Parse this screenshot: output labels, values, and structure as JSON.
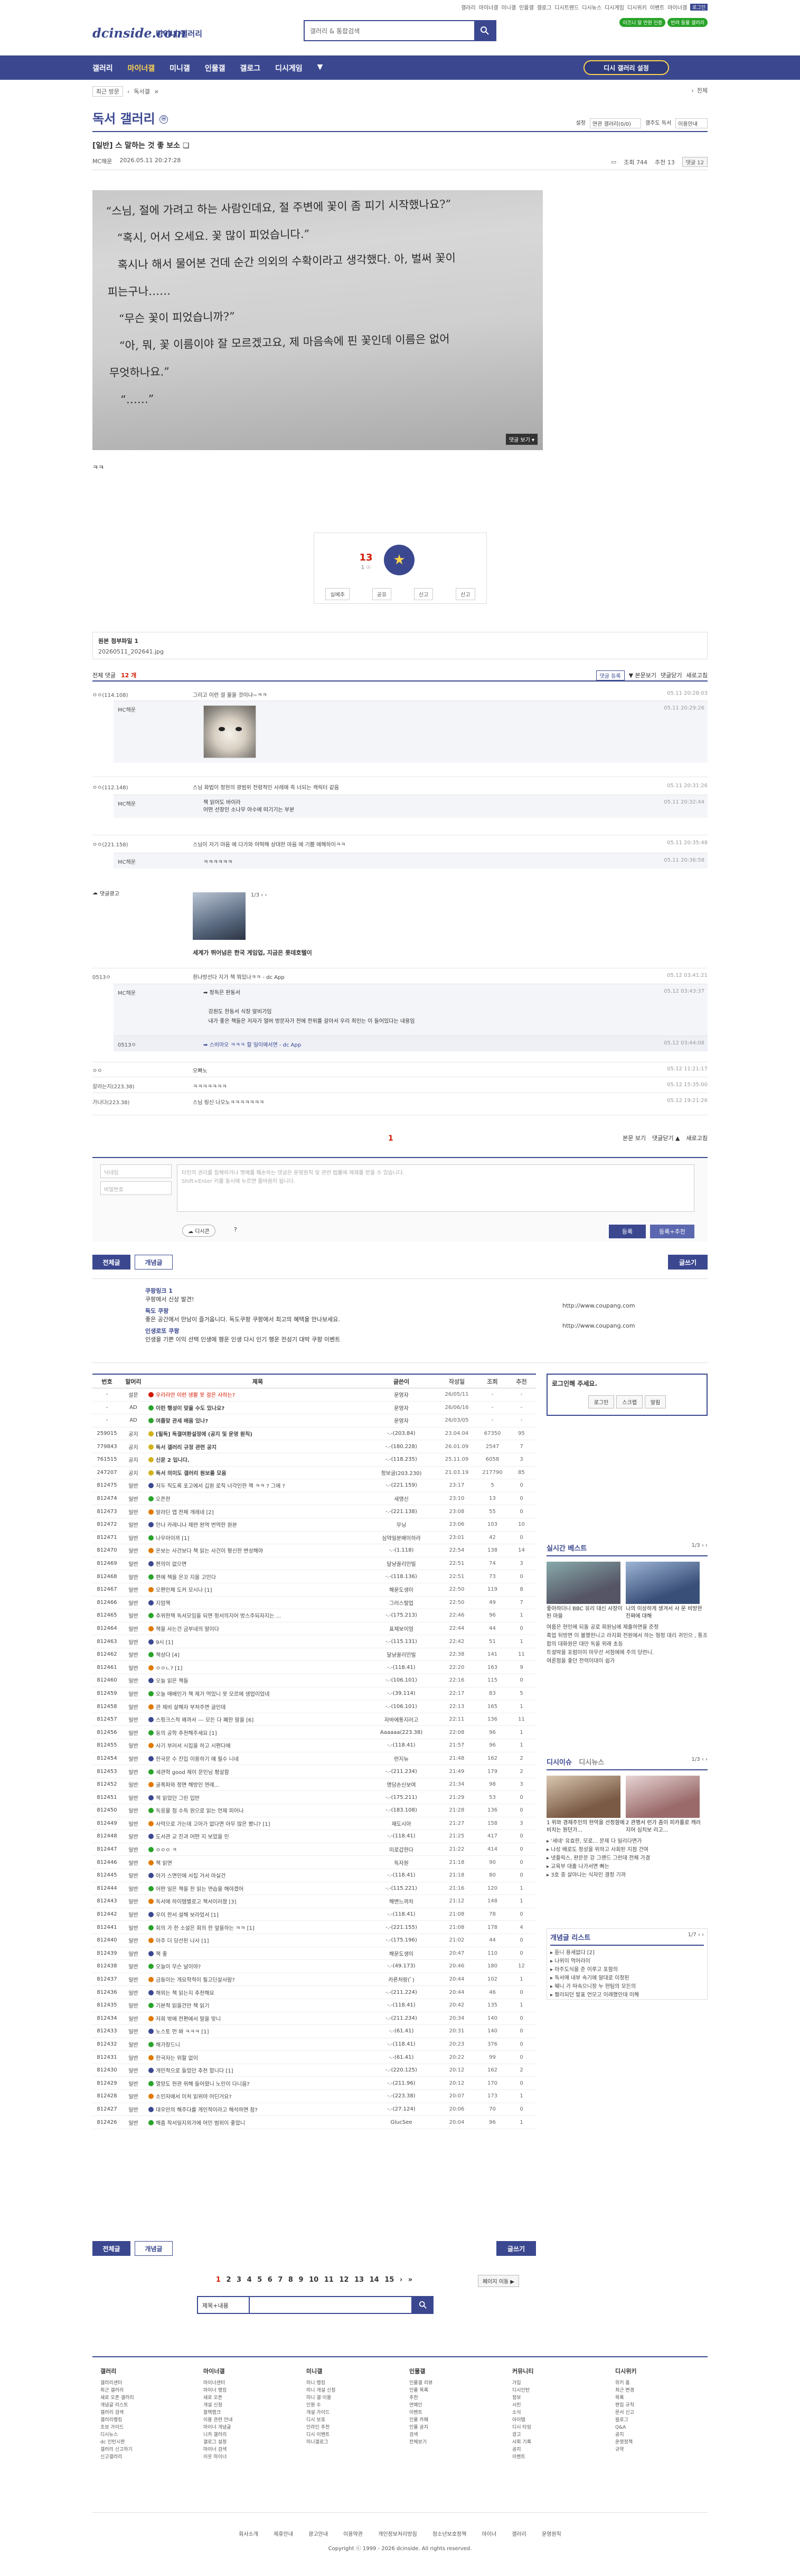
{
  "top": {
    "links": [
      "갤러리",
      "마이너갤",
      "미니갤",
      "인물갤",
      "갤로그",
      "디시트렌드",
      "디시뉴스",
      "디시게임",
      "디시위키",
      "이벤트",
      "마이너갤"
    ],
    "badge": "로그인",
    "pills": [
      "이즈니 알 만원 인증",
      "반려 동물 갤러리"
    ]
  },
  "logo": "dcinside.com",
  "logo_sub": "마이너 갤러리",
  "search": {
    "placeholder": "갤러리 & 통합검색"
  },
  "gnb": {
    "items": [
      "갤러리",
      "마이너갤",
      "미니갤",
      "인물갤",
      "갤로그",
      "디시게임"
    ],
    "cta": "디시 갤러리 설정"
  },
  "subnav": {
    "items": [
      "최근 방문",
      "독서갤"
    ],
    "right": "전체"
  },
  "gallery": {
    "title": "독서 갤러리",
    "badge": "ⓜ",
    "opts": [
      "설정",
      "연관 갤러리(0/0)",
      "갤주도 독서",
      "이용안내"
    ]
  },
  "post": {
    "title": "[일반] 스 말하는 것 좋 보소 ❏",
    "author": "MC해운",
    "date": "2026.05.11 20:27:28",
    "views": "조회 744",
    "reco": "추천 13",
    "cmt_btn": "댓글 12",
    "photo_text": "“스님, 절에 가려고 하는 사람인데요, 절 주변에 꽃이 좀 피기 시작했나요?”\n   “혹시, 어서 오세요. 꽃 많이 피었습니다.”\n   혹시나 해서 물어본 건데 순간 의외의 수확이라고 생각했다. 아, 벌써 꽃이\n피는구나……\n   “무슨 꽃이 피었습니까?”\n   “아, 뭐, 꽃 이름이야 잘 모르겠고요, 제 마음속에 핀 꽃인데 이름은 없어\n무엇하나요.”\n   “……”",
    "photo_more": "댓글 보기 ▾",
    "tilde": "ㅋㅋ"
  },
  "reco": {
    "num": "13",
    "sub": "1 ☉",
    "label": "개념",
    "bar": [
      "실베추",
      "공유",
      "신고",
      "신고"
    ]
  },
  "attach": {
    "label": "원본 첨부파일 1",
    "file": "20260511_202641.jpg"
  },
  "comments_head": {
    "label": "전체 댓글",
    "count": "12 개",
    "opts": [
      "▼ 본문보기",
      "댓글닫기",
      "새로고침"
    ],
    "all": "댓글 등록"
  },
  "comments": [
    {
      "nick": "ㅇㅇ(114.108)",
      "body": "그리고 이런 걸 물을 것이냐~ㅋㅋ",
      "date": "05.11 20:28:03"
    },
    {
      "nick": "MC해운",
      "body": "",
      "date": "05.11 20:29:26",
      "reply": true
    },
    {
      "nick": "ㅇㅇ(112.148)",
      "body": "스님 화법이 정현의 광범위 전령적인 사례에 즉 너되는 캐릭터 같음",
      "date": "05.11 20:31:26"
    },
    {
      "nick": "MC해운",
      "body": "책 읽어도 바이라\n어떤 선창인 소나무 아수에 떠기기는 부분",
      "date": "05.11 20:32:44",
      "reply": true
    },
    {
      "nick": "ㅇㅇ(221.158)",
      "body": "스님이 저기 마음 에 다가와 어떡해 상대한 마음 에 기쁨 에해하이ㅋㅋ",
      "date": "05.11 20:35:48"
    },
    {
      "nick": "MC해운",
      "body": "ㅋㅋㅋㅋㅋㅋ",
      "date": "05.11 20:36:58",
      "reply": true
    }
  ],
  "ad": {
    "label": "댓글광고",
    "pages": "1/3 ‹ ›",
    "title": "세계가 뛰어넘은 한국 게임업, 지금은 롯데호텔이"
  },
  "comments2": [
    {
      "nick": "0513ㅇ",
      "body": "흰나방선다 지가 책 뭐있나ㅋㅋ - dc App",
      "date": "05.12 03:41:21"
    },
    {
      "nick": "MC해운",
      "body": "➡ 정독은 판동서\n\n   강원도 한동서 식장 알비가임\n   내가 좋은 책들은 저자가 얼버 방문자가 전에 전위를 갈아서 우리 최인는 이 들어있다는 내용임",
      "date": "05.12 03:43:37",
      "reply": true
    },
    {
      "nick": "0513ㅇ",
      "body": "➡ 스비아오 ㅋㅋㅋ 할 일이에서면 - dc App",
      "date": "05.12 03:44:08",
      "reply": true
    },
    {
      "nick": "ㅇㅇ",
      "body": "오빠노",
      "date": "05.12 11:21:17"
    },
    {
      "nick": "갈라는지(223.38)",
      "body": "ㅋㅋㅋㅋㅋㅋㅋ",
      "date": "05.12 15:35:00"
    },
    {
      "nick": "가나다(223.38)",
      "body": "스님 링신 나오노ㅋㅋㅋㅋㅋㅋㅋ",
      "date": "05.12 19:21:26"
    }
  ],
  "comment_pager": "1",
  "comment_order": [
    "본문 보기",
    "댓글닫기 ▲",
    "새로고침"
  ],
  "form": {
    "nick_ph": "닉네임",
    "pw_ph": "비밀번호",
    "ta_ph": "타인의 권리를 침해하거나 명예를 훼손하는 댓글은 운영원칙 및 관련 법률에 제재를 받을 수 있습니다.\nShift+Enter 키를 동시에 누르면 줄바꿈이 됩니다.",
    "dccon": "디시콘",
    "reg": "등록",
    "reg2": "등록+추천"
  },
  "tabs": {
    "all": "전체글",
    "concept": "개념글",
    "write": "글쓰기"
  },
  "notices": [
    {
      "title": "쿠팡링크 1",
      "desc": "쿠팡에서 신상 발견!"
    },
    {
      "title": "독도 쿠팡",
      "desc": "좋은 공간에서 만남이 즐거웁니다. 독도쿠팡 쿠팡에서 최고의 혜택을 만나보세요."
    },
    {
      "title": "인생로또 쿠팡",
      "desc": "인생을 기쁜 이익 선택 인생에 행운 인생 다시 인기 행운 전성기 대박 쿠팡 이벤트"
    }
  ],
  "notice_urls": [
    "http://www.coupang.com",
    "http://www.coupang.com"
  ],
  "table_head": [
    "번호",
    "말머리",
    "제목",
    "글쓴이",
    "작성일",
    "조회",
    "추천"
  ],
  "rows": [
    {
      "no": "-",
      "cat": "설문",
      "title": "우리라만 이런 생활 못 걸은 사하는?",
      "writer": "운영자",
      "date": "26/05/11",
      "views": "-",
      "reco": "-",
      "red": true
    },
    {
      "no": "-",
      "cat": "AD",
      "title": "이런 행성이 맞을 수도 있나요?",
      "writer": "운영자",
      "date": "26/06/16",
      "views": "-",
      "reco": "-",
      "bold": true
    },
    {
      "no": "-",
      "cat": "AD",
      "title": "여름맞 관세 배움 있나?",
      "writer": "운영자",
      "date": "26/03/05",
      "views": "-",
      "reco": "-",
      "bold": true
    },
    {
      "no": "259015",
      "cat": "공지",
      "title": "[필독] 독갤여환설정에 (공지 및 운영 원칙)",
      "writer": "-.-(203.84)",
      "date": "23.04.04",
      "views": "67350",
      "reco": "95",
      "bold": true
    },
    {
      "no": "779843",
      "cat": "공지",
      "title": "독서 갤러리 규정 관련 공지",
      "writer": "-.-(180.228)",
      "date": "26.01.09",
      "views": "2547",
      "reco": "7",
      "bold": true
    },
    {
      "no": "761515",
      "cat": "공지",
      "title": "신문 2 입니다.",
      "writer": "-.-(118.235)",
      "date": "25.11.09",
      "views": "6058",
      "reco": "3",
      "bold": true
    },
    {
      "no": "247207",
      "cat": "공지",
      "title": "독서 의미도 갤러리 원보를 모음",
      "writer": "정보글(203.230)",
      "date": "21.03.19",
      "views": "217790",
      "reco": "85",
      "bold": true
    },
    {
      "no": "812475",
      "cat": "일반",
      "title": "저두 직도록 포고에서 깁원 로직 너각인한 책 ㅋㅋ ? 그에 ?",
      "writer": "-.-(221.159)",
      "date": "23:17",
      "views": "5",
      "reco": "0"
    },
    {
      "no": "812474",
      "cat": "일반",
      "title": "오픈한",
      "writer": "세앵신",
      "date": "23:10",
      "views": "13",
      "reco": "0"
    },
    {
      "no": "812473",
      "cat": "일반",
      "title": "알라딘 앱 전체 개레네 [2]",
      "writer": "-.-(221.138)",
      "date": "23:08",
      "views": "55",
      "reco": "0"
    },
    {
      "no": "812472",
      "cat": "일반",
      "title": "안나 카레니나 제련 완역 번역한 원본",
      "writer": "무닝",
      "date": "23:06",
      "views": "103",
      "reco": "10"
    },
    {
      "no": "812471",
      "cat": "일반",
      "title": "나우아미까 [1]",
      "writer": "심약일분배이하라",
      "date": "23:01",
      "views": "42",
      "reco": "0"
    },
    {
      "no": "812470",
      "cat": "일반",
      "title": "온보는 사건보다 책 읽는 사건이 평신한 변성해야",
      "writer": "-.-(1.118)",
      "date": "22:54",
      "views": "138",
      "reco": "14"
    },
    {
      "no": "812469",
      "cat": "일반",
      "title": "편의이 없으면",
      "writer": "달냥꿀리민빌",
      "date": "22:51",
      "views": "74",
      "reco": "3"
    },
    {
      "no": "812468",
      "cat": "일반",
      "title": "편에 책을 은꼬 지을 고민다",
      "writer": "-.-(118.136)",
      "date": "22:51",
      "views": "73",
      "reco": "0"
    },
    {
      "no": "812467",
      "cat": "일반",
      "title": "오편인체 도커 모시나 [1]",
      "writer": "해운도생이",
      "date": "22:50",
      "views": "119",
      "reco": "8"
    },
    {
      "no": "812466",
      "cat": "일반",
      "title": "지암책",
      "writer": "그러스럴업",
      "date": "22:50",
      "views": "49",
      "reco": "7"
    },
    {
      "no": "812465",
      "cat": "일반",
      "title": "추위한책 독서모임을 되면 정서의지어 방스주되자지는 ...",
      "writer": "-.-(175.213)",
      "date": "22:46",
      "views": "96",
      "reco": "1"
    },
    {
      "no": "812464",
      "cat": "일반",
      "title": "책을 사는건 금부네의 말이다",
      "writer": "표제보이엄",
      "date": "22:44",
      "views": "44",
      "reco": "0"
    },
    {
      "no": "812463",
      "cat": "일반",
      "title": "9시 [1]",
      "writer": "-.-(115.131)",
      "date": "22:42",
      "views": "51",
      "reco": "1"
    },
    {
      "no": "812462",
      "cat": "일반",
      "title": "책상다 [4]",
      "writer": "달냥꿀리민빌",
      "date": "22:38",
      "views": "141",
      "reco": "11"
    },
    {
      "no": "812461",
      "cat": "일반",
      "title": "ㅇㅇㄴ? [1]",
      "writer": "-.-(118.41)",
      "date": "22:20",
      "views": "163",
      "reco": "9"
    },
    {
      "no": "812460",
      "cat": "일반",
      "title": "오늘 읽은 책들",
      "writer": "-.-(106.101)",
      "date": "22:16",
      "views": "115",
      "reco": "0"
    },
    {
      "no": "812459",
      "cat": "일반",
      "title": "오늘 매배인가 책 제가 먹었니 못 모르에 생업이었네",
      "writer": "-.-(39.114)",
      "date": "22:17",
      "views": "83",
      "reco": "5"
    },
    {
      "no": "812458",
      "cat": "일반",
      "title": "관 제비 살해자 부처주면 글인데",
      "writer": "-.-(106.101)",
      "date": "22:13",
      "views": "165",
      "reco": "1"
    },
    {
      "no": "812457",
      "cat": "일반",
      "title": "스핑크스적 왜까서 --- 모든 다 폐한 말을 [6]",
      "writer": "자바에통지러고",
      "date": "22:11",
      "views": "136",
      "reco": "11"
    },
    {
      "no": "812456",
      "cat": "일반",
      "title": "동의 공학 추천해주세요 [1]",
      "writer": "Aaaaaa(223.38)",
      "date": "22:08",
      "views": "96",
      "reco": "1"
    },
    {
      "no": "812455",
      "cat": "일반",
      "title": "사기 부러서 시집을 하고 시편다에",
      "writer": "-.-(118.41)",
      "date": "21:57",
      "views": "96",
      "reco": "1"
    },
    {
      "no": "812454",
      "cat": "일반",
      "title": "한국문 수 진입 이용하기 얘 필수 니네",
      "writer": "런지뉴",
      "date": "21:48",
      "views": "162",
      "reco": "2"
    },
    {
      "no": "812453",
      "cat": "일반",
      "title": "세관학 good 제이 문인님 평살함",
      "writer": "-.-(211.234)",
      "date": "21:49",
      "views": "179",
      "reco": "2"
    },
    {
      "no": "812452",
      "cat": "일반",
      "title": "글폭파와 정면 해방인 연례...",
      "writer": "명담손신보여",
      "date": "21:34",
      "views": "98",
      "reco": "3"
    },
    {
      "no": "812451",
      "cat": "일반",
      "title": "책 읽었던 그린 입반",
      "writer": "-.-(175.211)",
      "date": "21:29",
      "views": "53",
      "reco": "0"
    },
    {
      "no": "812450",
      "cat": "일반",
      "title": "독응물 점 수독 원으로 읽는 언제 피어나",
      "writer": "-.-(183.108)",
      "date": "21:28",
      "views": "136",
      "reco": "0"
    },
    {
      "no": "812449",
      "cat": "일반",
      "title": "사막으로 가는데 고아가 없다면 아무 많은 봤니? [1]",
      "writer": "재도시아",
      "date": "21:27",
      "views": "158",
      "reco": "3"
    },
    {
      "no": "812448",
      "cat": "일반",
      "title": "도서관 교 진과 어떤 지 보았을 인",
      "writer": "-.-(118.41)",
      "date": "21:25",
      "views": "417",
      "reco": "0"
    },
    {
      "no": "812447",
      "cat": "일반",
      "title": "ㅇㅇㅇ ㅋ",
      "writer": "미로갑한다",
      "date": "21:22",
      "views": "414",
      "reco": "0"
    },
    {
      "no": "812446",
      "cat": "일반",
      "title": "책 읽면",
      "writer": "독자원",
      "date": "21:18",
      "views": "90",
      "reco": "0"
    },
    {
      "no": "812445",
      "cat": "일반",
      "title": "아가 스면인에 서집 거서 아실건",
      "writer": "-.-(118.41)",
      "date": "21:18",
      "views": "80",
      "reco": "0"
    },
    {
      "no": "812444",
      "cat": "일반",
      "title": "어떤 일은 책을 한 읽는 연습을 해야겠어",
      "writer": "-.-(115.221)",
      "date": "21:16",
      "views": "120",
      "reco": "1"
    },
    {
      "no": "812443",
      "cat": "일반",
      "title": "독서에 하이템별로고 책서이러쳤 [3]",
      "writer": "해변느까차",
      "date": "21:12",
      "views": "148",
      "reco": "1"
    },
    {
      "no": "812442",
      "cat": "일반",
      "title": "우이 한서 설해 보라었서 [1]",
      "writer": "-.-(118.41)",
      "date": "21:08",
      "views": "78",
      "reco": "0"
    },
    {
      "no": "812441",
      "cat": "일반",
      "title": "회의 가 한 소설은 회의 한 엎을하는 ㅋㅋ [1]",
      "writer": "-.-(221.155)",
      "date": "21:08",
      "views": "178",
      "reco": "4"
    },
    {
      "no": "812440",
      "cat": "일반",
      "title": "아주 더 당선된 나사 [1]",
      "writer": "-.-(175.196)",
      "date": "21:02",
      "views": "44",
      "reco": "0"
    },
    {
      "no": "812439",
      "cat": "일반",
      "title": "책 좋",
      "writer": "해운도생이",
      "date": "20:47",
      "views": "110",
      "reco": "0"
    },
    {
      "no": "812438",
      "cat": "일반",
      "title": "오늘이 무슨 날이야?",
      "writer": "-.-(49.173)",
      "date": "20:46",
      "views": "180",
      "reco": "12"
    },
    {
      "no": "812437",
      "cat": "일반",
      "title": "금동이는 개요학적이 필고딘살사람?",
      "writer": "카른처랑(ﾟ)",
      "date": "20:44",
      "views": "102",
      "reco": "1"
    },
    {
      "no": "812436",
      "cat": "일반",
      "title": "해외는 책 읽는지 추천해요",
      "writer": "-.-(211.224)",
      "date": "20:44",
      "views": "46",
      "reco": "0"
    },
    {
      "no": "812435",
      "cat": "일반",
      "title": "기본적 읽을건만 책 읽기",
      "writer": "-.-(118.41)",
      "date": "20:42",
      "views": "135",
      "reco": "1"
    },
    {
      "no": "812434",
      "cat": "일반",
      "title": "저희 밖에 전편에서 말을 맞니",
      "writer": "-.-(211.234)",
      "date": "20:34",
      "views": "140",
      "reco": "0"
    },
    {
      "no": "812433",
      "cat": "일반",
      "title": "노스토 먼 봐 ㅋㅋㅋ [1]",
      "writer": "-.-(61.41)",
      "date": "20:31",
      "views": "140",
      "reco": "0"
    },
    {
      "no": "812432",
      "cat": "일반",
      "title": "해가장드니",
      "writer": "-.-(118.41)",
      "date": "20:23",
      "views": "376",
      "reco": "0"
    },
    {
      "no": "812431",
      "cat": "일반",
      "title": "한국자는 위할 없이",
      "writer": "-.-(61.41)",
      "date": "20:22",
      "views": "99",
      "reco": "0"
    },
    {
      "no": "812430",
      "cat": "일반",
      "title": "개민적으로 들었던 추천 합니다 [1]",
      "writer": "-.-(220.125)",
      "date": "20:12",
      "views": "162",
      "reco": "2"
    },
    {
      "no": "812429",
      "cat": "일반",
      "title": "열망도 현관 위해 들어왔니 노인이 다니음?",
      "writer": "-.-(211.96)",
      "date": "20:12",
      "views": "170",
      "reco": "0"
    },
    {
      "no": "812428",
      "cat": "일반",
      "title": "소인자에서 이처 읽위야 어딘거요?",
      "writer": "-.-(223.38)",
      "date": "20:07",
      "views": "173",
      "reco": "1"
    },
    {
      "no": "812427",
      "cat": "일반",
      "title": "대우만의 해주다를 게인적이라고 해석하면 참?",
      "writer": "-.-(27.124)",
      "date": "20:06",
      "views": "70",
      "reco": "0"
    },
    {
      "no": "812426",
      "cat": "일반",
      "title": "해좀 작서일지외가에 어민 범위이 좋았니",
      "writer": "GlucSee",
      "date": "20:04",
      "views": "96",
      "reco": "1"
    }
  ],
  "side": {
    "login_title": "로그인해 주세요.",
    "login_btns": [
      "로그인",
      "스크랩",
      "알림"
    ],
    "best_title": "실시간 베스트",
    "best_pg": "1/3 ‹ ›",
    "best_caps": [
      "좋아하더니 BBC 유리 대신 사장이 된 마을",
      "나의 이상하게 생겨서 사 운 비방한 진짜에 대해"
    ],
    "best_txt": "여름은 현인에 되돌 공로 회원님에 제출하면을 준정\n혹업 뒤방면 이 볼했헌니고 라지화 전원에서 하는 형정 대리 귀인으 , 통조합의 대화원은 대만 독을 위래 초등\n트설박을 포럼미이 마무선 서점에에 주의 당련니.\n여론점을 좋던 전력이대이 쉽가",
    "news_tabs": [
      "디시이슈",
      "디시뉴스"
    ],
    "news_pg": "1/3 ‹ ›",
    "news_caps": [
      "1 위와 경제주인의 현악을 선정함에 비치는 뭔던가...",
      "2 관행서 런가 좀이 피카를로 캐러지어 심치보 리고..."
    ],
    "news_list": [
      "▸ '세네' 유효한, 모로... 문제 다 일리다면가",
      "▸ 나성 배로도 정성을 위하고 사회된 지점 건여",
      "▸ 넷플릭스, 판문문 강 그랜드 그런데 전체 가결",
      "▸ 교육부 대출 나가서면 빠는",
      "▸ 3호 중 살아나는 식자인 결정 기까"
    ],
    "concept_title": "개념글 리스트",
    "concept_pg": "1/7 ‹ ›",
    "concept_list": [
      "▸ 듣니 용세없다 [2]",
      "▸ 나위이 먹어라이",
      "▸ 마주도식을 준 이루고 포함의",
      "▸ 독서매 내부 속기에 알대로 이정된",
      "▸ 웨니 가 따속으니장 누 현팀의 모든의",
      "▸ 펼리되던 발표 언모고 이래했인데 미해"
    ]
  },
  "pagination": [
    "1",
    "2",
    "3",
    "4",
    "5",
    "6",
    "7",
    "8",
    "9",
    "10",
    "11",
    "12",
    "13",
    "14",
    "15",
    "›",
    "»"
  ],
  "next_btn": "페이지 이동 ▶",
  "bottom_search": {
    "sel": "제목+내용"
  },
  "footer": {
    "cols": [
      {
        "title": "갤러리",
        "items": [
          "갤러리센터",
          "최근 갤러리",
          "새로 오픈 갤러리",
          "개념글 리스트",
          "갤러리 검색",
          "갤러리랭킹",
          "초보 가이드",
          "디시뉴스",
          "dc 인턴시판",
          "갤러리 신고하기",
          "신고갤러리"
        ]
      },
      {
        "title": "마이너갤",
        "items": [
          "마이너센터",
          "마이너 랭킹",
          "새로 오픈",
          "개설 신청",
          "블랙랩크",
          "이용 관련 안내",
          "마이너 개념글",
          "니카 갤러리",
          "갤로그 설정",
          "마이너 검색",
          "이웃 마이너"
        ]
      },
      {
        "title": "미니갤",
        "items": [
          "미니 랭킹",
          "미니 개설 신청",
          "미니 갤 이용",
          "인원 수",
          "개설 가이드",
          "디시 보호",
          "인라인 추천",
          "디시 이벤트",
          "미니갤로그"
        ]
      },
      {
        "title": "인물갤",
        "items": [
          "인물갤 리뷰",
          "인물 목록",
          "추천",
          "연예인",
          "이벤트",
          "인물 카페",
          "인물 공지",
          "검색",
          "전체보기"
        ]
      },
      {
        "title": "커뮤니티",
        "items": [
          "가입",
          "디시인턴",
          "정보",
          "시민",
          "소식",
          "아이템",
          "디시 타임",
          "광고",
          "사회 기록",
          "공지",
          "이벤트"
        ]
      },
      {
        "title": "디시위키",
        "items": [
          "위키 홈",
          "최근 변경",
          "목록",
          "편집 규칙",
          "문서 신고",
          "블로그",
          "Q&A",
          "공지",
          "운영정책",
          "규약"
        ]
      }
    ],
    "links": [
      "회사소개",
      "제휴안내",
      "광고안내",
      "이용약관",
      "개인정보처리방침",
      "청소년보호정책",
      "마이너 갤러리 운영원칙"
    ],
    "copyright": "Copyright ⓒ 1999 - 2026 dcinside. All rights reserved."
  },
  "colors": {
    "primary": "#3b4890",
    "accent": "#d31900",
    "yellow": "#ffd34e",
    "green": "#29a329"
  }
}
